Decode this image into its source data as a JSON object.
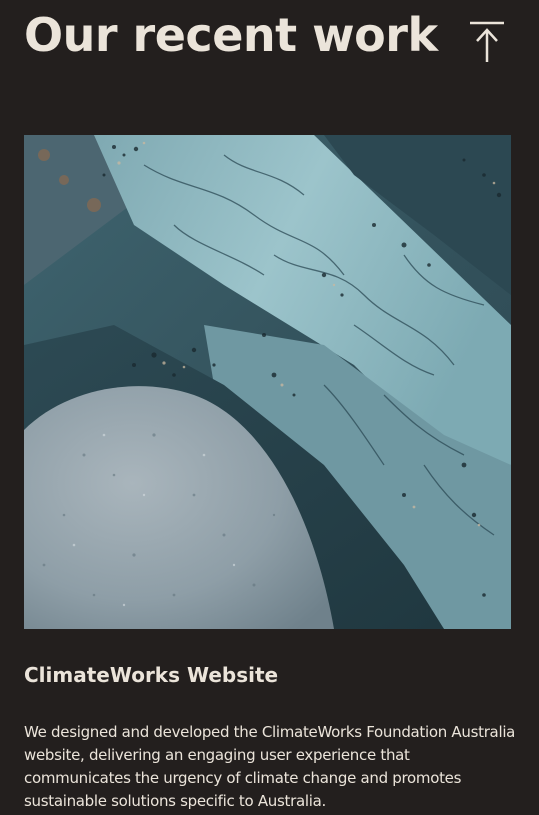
{
  "page": {
    "title": "Our recent work"
  },
  "scroll_top": {
    "icon": "arrow-up-to-line-icon"
  },
  "project": {
    "image_icon": "rock-texture-photo",
    "title": "ClimateWorks Website",
    "description": "We designed and developed the ClimateWorks Foundation Australia website, delivering an engaging user experience that communicates the urgency of climate change and promotes sustainable solutions specific to Australia."
  },
  "colors": {
    "background": "#231f1e",
    "text": "#ebe4da"
  }
}
